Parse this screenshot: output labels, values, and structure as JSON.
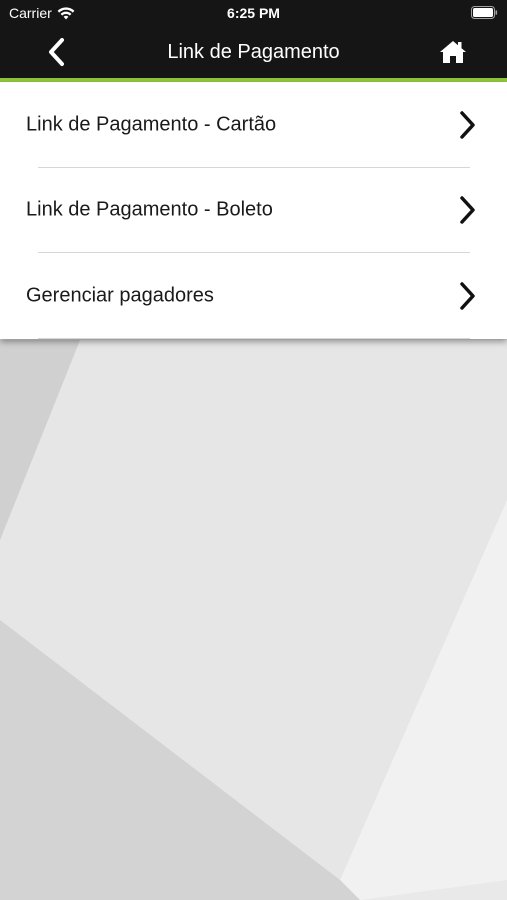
{
  "status_bar": {
    "carrier": "Carrier",
    "time": "6:25 PM"
  },
  "nav": {
    "title": "Link de Pagamento",
    "back_icon": "chevron-left-icon",
    "home_icon": "home-icon"
  },
  "menu": {
    "items": [
      {
        "label": "Link de Pagamento - Cartão"
      },
      {
        "label": "Link de Pagamento - Boleto"
      },
      {
        "label": "Gerenciar pagadores"
      }
    ]
  },
  "colors": {
    "header_bg": "#151515",
    "accent": "#8dc63f",
    "menu_bg": "#ffffff"
  }
}
